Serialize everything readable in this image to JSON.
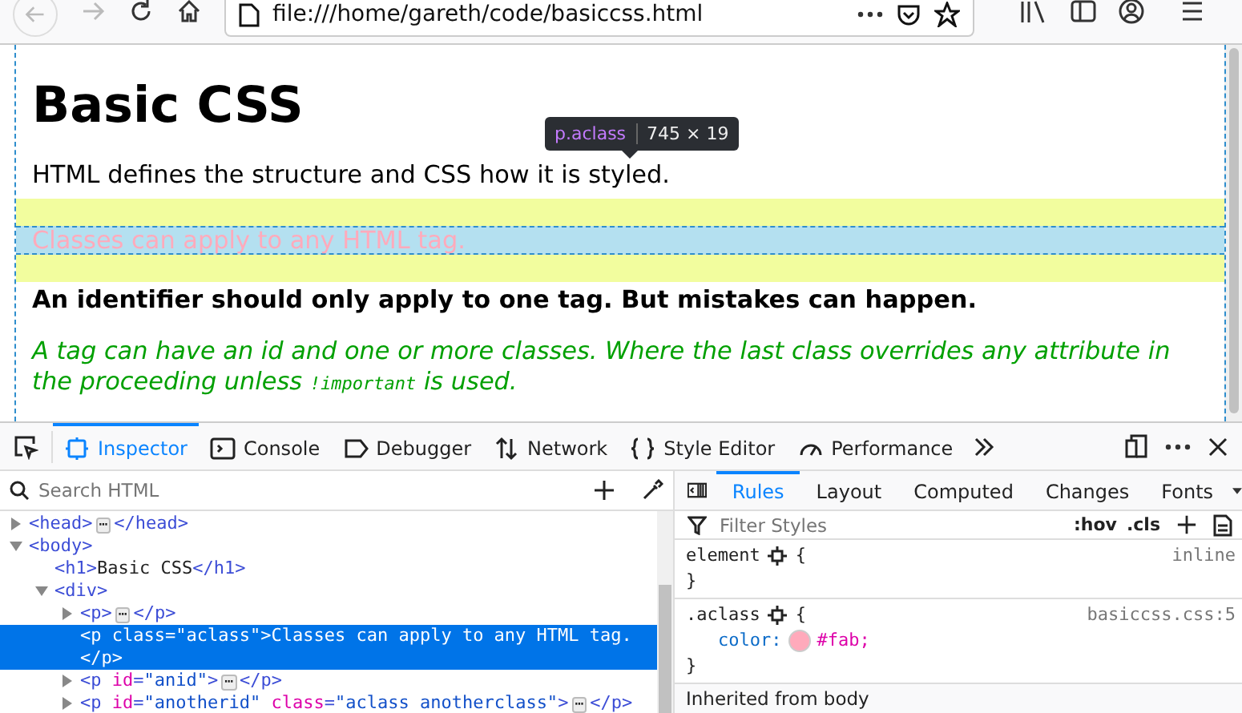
{
  "browser": {
    "url": "file:///home/gareth/code/basiccss.html"
  },
  "page": {
    "heading": "Basic CSS",
    "paragraphs": [
      {
        "kind": "plain",
        "text": "HTML defines the structure and CSS how it is styled."
      },
      {
        "kind": "highlighted",
        "text": "Classes can apply to any HTML tag."
      },
      {
        "kind": "bold",
        "text": "An identifier should only apply to one tag. But mistakes can happen."
      },
      {
        "kind": "italic",
        "text": "A tag can have an id and one or more classes. Where the last class overrides any attribute in the proceeding unless ",
        "code": "!important",
        "after": " is used."
      }
    ],
    "tooltip": {
      "selector": "p.aclass",
      "size": "745 × 19"
    }
  },
  "devtools": {
    "tabs": [
      {
        "label": "Inspector",
        "selected": true
      },
      {
        "label": "Console",
        "selected": false
      },
      {
        "label": "Debugger",
        "selected": false
      },
      {
        "label": "Network",
        "selected": false
      },
      {
        "label": "Style Editor",
        "selected": false
      },
      {
        "label": "Performance",
        "selected": false
      }
    ],
    "search": {
      "placeholder": "Search HTML"
    },
    "dom_tree": [
      {
        "expanded": false,
        "selected": false,
        "tokens": [
          {
            "kind": "tag",
            "text": "<head>"
          },
          {
            "kind": "ellipsis",
            "text": "⋯"
          },
          {
            "kind": "tag",
            "text": "</head>"
          }
        ]
      },
      {
        "expanded": true,
        "selected": false,
        "tokens": [
          {
            "kind": "tag",
            "text": "<body>"
          }
        ],
        "children": [
          {
            "selected": false,
            "tokens": [
              {
                "kind": "tag",
                "text": "<h1>"
              },
              {
                "kind": "text",
                "text": "Basic CSS"
              },
              {
                "kind": "tag",
                "text": "</h1>"
              }
            ]
          },
          {
            "expanded": true,
            "selected": false,
            "tokens": [
              {
                "kind": "tag",
                "text": "<div>"
              }
            ],
            "children": [
              {
                "expanded": false,
                "selected": false,
                "tokens": [
                  {
                    "kind": "tag",
                    "text": "<p>"
                  },
                  {
                    "kind": "ellipsis",
                    "text": "⋯"
                  },
                  {
                    "kind": "tag",
                    "text": "</p>"
                  }
                ]
              },
              {
                "selected": true,
                "tokens": [
                  {
                    "kind": "tag",
                    "text": "<p "
                  },
                  {
                    "kind": "attr",
                    "text": "class"
                  },
                  {
                    "kind": "tag",
                    "text": "="
                  },
                  {
                    "kind": "value",
                    "text": "\"aclass\""
                  },
                  {
                    "kind": "tag",
                    "text": ">"
                  },
                  {
                    "kind": "text",
                    "text": "Classes can apply to any HTML tag. "
                  },
                  {
                    "kind": "tag",
                    "text": "</p>"
                  }
                ]
              },
              {
                "expanded": false,
                "selected": false,
                "tokens": [
                  {
                    "kind": "tag",
                    "text": "<p "
                  },
                  {
                    "kind": "attr",
                    "text": "id"
                  },
                  {
                    "kind": "tag",
                    "text": "="
                  },
                  {
                    "kind": "value",
                    "text": "\"anid\""
                  },
                  {
                    "kind": "tag",
                    "text": ">"
                  },
                  {
                    "kind": "ellipsis",
                    "text": "⋯"
                  },
                  {
                    "kind": "tag",
                    "text": "</p>"
                  }
                ]
              },
              {
                "expanded": false,
                "selected": false,
                "tokens": [
                  {
                    "kind": "tag",
                    "text": "<p "
                  },
                  {
                    "kind": "attr",
                    "text": "id"
                  },
                  {
                    "kind": "tag",
                    "text": "="
                  },
                  {
                    "kind": "value",
                    "text": "\"anotherid\" "
                  },
                  {
                    "kind": "attr",
                    "text": "class"
                  },
                  {
                    "kind": "tag",
                    "text": "="
                  },
                  {
                    "kind": "value",
                    "text": "\"aclass anotherclass\""
                  },
                  {
                    "kind": "tag",
                    "text": ">"
                  },
                  {
                    "kind": "ellipsis",
                    "text": "⋯"
                  },
                  {
                    "kind": "tag",
                    "text": "</p>"
                  }
                ]
              }
            ]
          }
        ]
      }
    ],
    "sidebar_tabs": [
      {
        "label": "Rules",
        "selected": true
      },
      {
        "label": "Layout",
        "selected": false
      },
      {
        "label": "Computed",
        "selected": false
      },
      {
        "label": "Changes",
        "selected": false
      },
      {
        "label": "Fonts",
        "selected": false
      }
    ],
    "filter": {
      "placeholder": "Filter Styles",
      "buttons": [
        ":hov",
        ".cls"
      ]
    },
    "rules": [
      {
        "selector": "element",
        "open_brace": "{",
        "source": "inline",
        "close_brace": "}"
      },
      {
        "selector": ".aclass",
        "open_brace": "{",
        "source": "basiccss.css:5",
        "declarations": [
          {
            "property": "color:",
            "value": "#fab;",
            "color": "#ffaabb"
          }
        ],
        "close_brace": "}"
      }
    ],
    "inherited_header": "Inherited from body"
  }
}
